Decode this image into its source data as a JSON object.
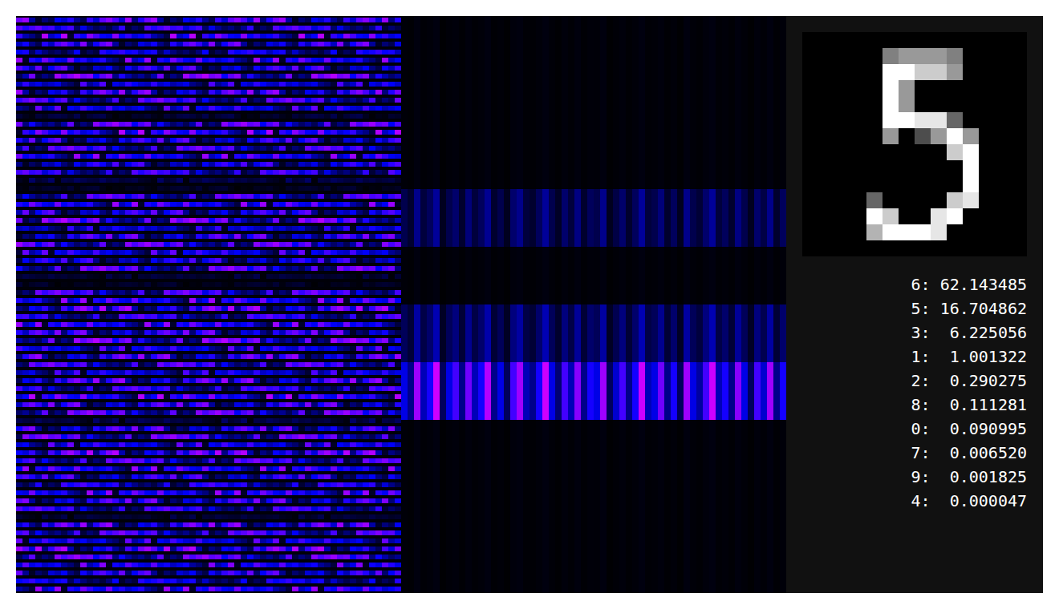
{
  "weights": {
    "rows": [
      0.8,
      0.7,
      0.85,
      0.75,
      0.6,
      0.8,
      0.7,
      0.85,
      0.65,
      0.8,
      0.75,
      0.7,
      0.15,
      0.8,
      0.85,
      0.7,
      0.75,
      0.8,
      0.65,
      0.7,
      0.2,
      0.1,
      0.75,
      0.8,
      0.7,
      0.85,
      0.6,
      0.75,
      0.8,
      0.7,
      0.65,
      0.8,
      0.15,
      0.1,
      0.75,
      0.8,
      0.85,
      0.7,
      0.8,
      0.75,
      0.85,
      0.7,
      0.8,
      0.75,
      0.65,
      0.8,
      0.7,
      0.85,
      0.75,
      0.8,
      0.2,
      0.75,
      0.8,
      0.7,
      0.85,
      0.75,
      0.8,
      0.7,
      0.65,
      0.8,
      0.75,
      0.7,
      0.15,
      0.8,
      0.75,
      0.7,
      0.85,
      0.8,
      0.75,
      0.7,
      0.6,
      0.8
    ],
    "pattern": [
      0.9,
      0.3,
      0.6,
      1,
      0.2,
      0.7,
      0.4,
      0.95,
      0.5,
      0.1,
      0.8,
      0.6,
      0.3,
      0.9,
      0.7,
      0.2,
      1,
      0.4,
      0.6,
      0.85,
      0.3,
      0.5,
      0.9,
      0.15,
      0.7,
      0.6,
      1,
      0.35,
      0.8,
      0.45,
      0.2,
      0.9,
      0.6,
      0.75,
      0.3,
      1,
      0.5,
      0.65,
      0.1,
      0.85,
      0.4,
      0.7,
      0.95,
      0.25,
      0.6,
      0.8,
      0.35,
      0.9,
      0.5,
      0.2,
      0.75,
      1,
      0.4,
      0.6,
      0.3,
      0.85,
      0.55,
      0.7,
      0.15,
      0.9
    ]
  },
  "activations": {
    "bands": [
      0.03,
      0.03,
      0.03,
      0.3,
      0.03,
      0.35,
      0.9,
      0.03,
      0.03,
      0.03
    ],
    "columns": [
      0.5,
      0.3,
      0.9,
      0.4,
      0.6,
      1,
      0.2,
      0.5,
      0.7,
      0.3,
      0.8,
      0.4,
      0.6,
      0.95,
      0.3,
      0.5,
      0.2,
      0.7,
      0.9,
      0.4,
      0.3,
      0.6,
      1,
      0.5,
      0.25,
      0.7,
      0.4,
      0.85,
      0.3,
      0.6,
      0.5,
      0.9,
      0.2,
      0.45,
      0.7,
      0.3,
      0.6,
      1,
      0.4,
      0.5,
      0.8,
      0.3,
      0.6,
      0.2,
      0.9,
      0.5,
      0.35,
      0.7,
      1,
      0.4,
      0.6,
      0.3,
      0.85,
      0.5,
      0.2,
      0.7,
      0.45,
      0.9,
      0.3,
      0.6
    ]
  },
  "input_image": [
    [
      0,
      0,
      0,
      0,
      0,
      0,
      0,
      0,
      0,
      0,
      0,
      0,
      0,
      0
    ],
    [
      0,
      0,
      0,
      0,
      0,
      0.5,
      0.6,
      0.6,
      0.6,
      0.5,
      0,
      0,
      0,
      0
    ],
    [
      0,
      0,
      0,
      0,
      0,
      1,
      1,
      0.8,
      0.8,
      0.6,
      0,
      0,
      0,
      0
    ],
    [
      0,
      0,
      0,
      0,
      0,
      1,
      0.6,
      0,
      0,
      0,
      0,
      0,
      0,
      0
    ],
    [
      0,
      0,
      0,
      0,
      0,
      1,
      0.6,
      0,
      0,
      0,
      0,
      0,
      0,
      0
    ],
    [
      0,
      0,
      0,
      0,
      0,
      1,
      1,
      0.9,
      0.9,
      0.4,
      0,
      0,
      0,
      0
    ],
    [
      0,
      0,
      0,
      0,
      0,
      0.6,
      0,
      0.3,
      0.6,
      1,
      0.6,
      0,
      0,
      0
    ],
    [
      0,
      0,
      0,
      0,
      0,
      0,
      0,
      0,
      0,
      0.8,
      1,
      0,
      0,
      0
    ],
    [
      0,
      0,
      0,
      0,
      0,
      0,
      0,
      0,
      0,
      0,
      1,
      0,
      0,
      0
    ],
    [
      0,
      0,
      0,
      0,
      0,
      0,
      0,
      0,
      0,
      0,
      1,
      0,
      0,
      0
    ],
    [
      0,
      0,
      0,
      0,
      0.4,
      0,
      0,
      0,
      0,
      0.8,
      0.9,
      0,
      0,
      0
    ],
    [
      0,
      0,
      0,
      0,
      1,
      0.8,
      0,
      0,
      0.9,
      1,
      0,
      0,
      0,
      0
    ],
    [
      0,
      0,
      0,
      0,
      0.7,
      1,
      1,
      1,
      0.9,
      0,
      0,
      0,
      0,
      0
    ],
    [
      0,
      0,
      0,
      0,
      0,
      0,
      0,
      0,
      0,
      0,
      0,
      0,
      0,
      0
    ]
  ],
  "predictions": [
    {
      "label": "6:",
      "value": "62.143485"
    },
    {
      "label": "5:",
      "value": "16.704862"
    },
    {
      "label": "3:",
      "value": "6.225056"
    },
    {
      "label": "1:",
      "value": "1.001322"
    },
    {
      "label": "2:",
      "value": "0.290275"
    },
    {
      "label": "8:",
      "value": "0.111281"
    },
    {
      "label": "0:",
      "value": "0.090995"
    },
    {
      "label": "7:",
      "value": "0.006520"
    },
    {
      "label": "9:",
      "value": "0.001825"
    },
    {
      "label": "4:",
      "value": "0.000047"
    }
  ]
}
